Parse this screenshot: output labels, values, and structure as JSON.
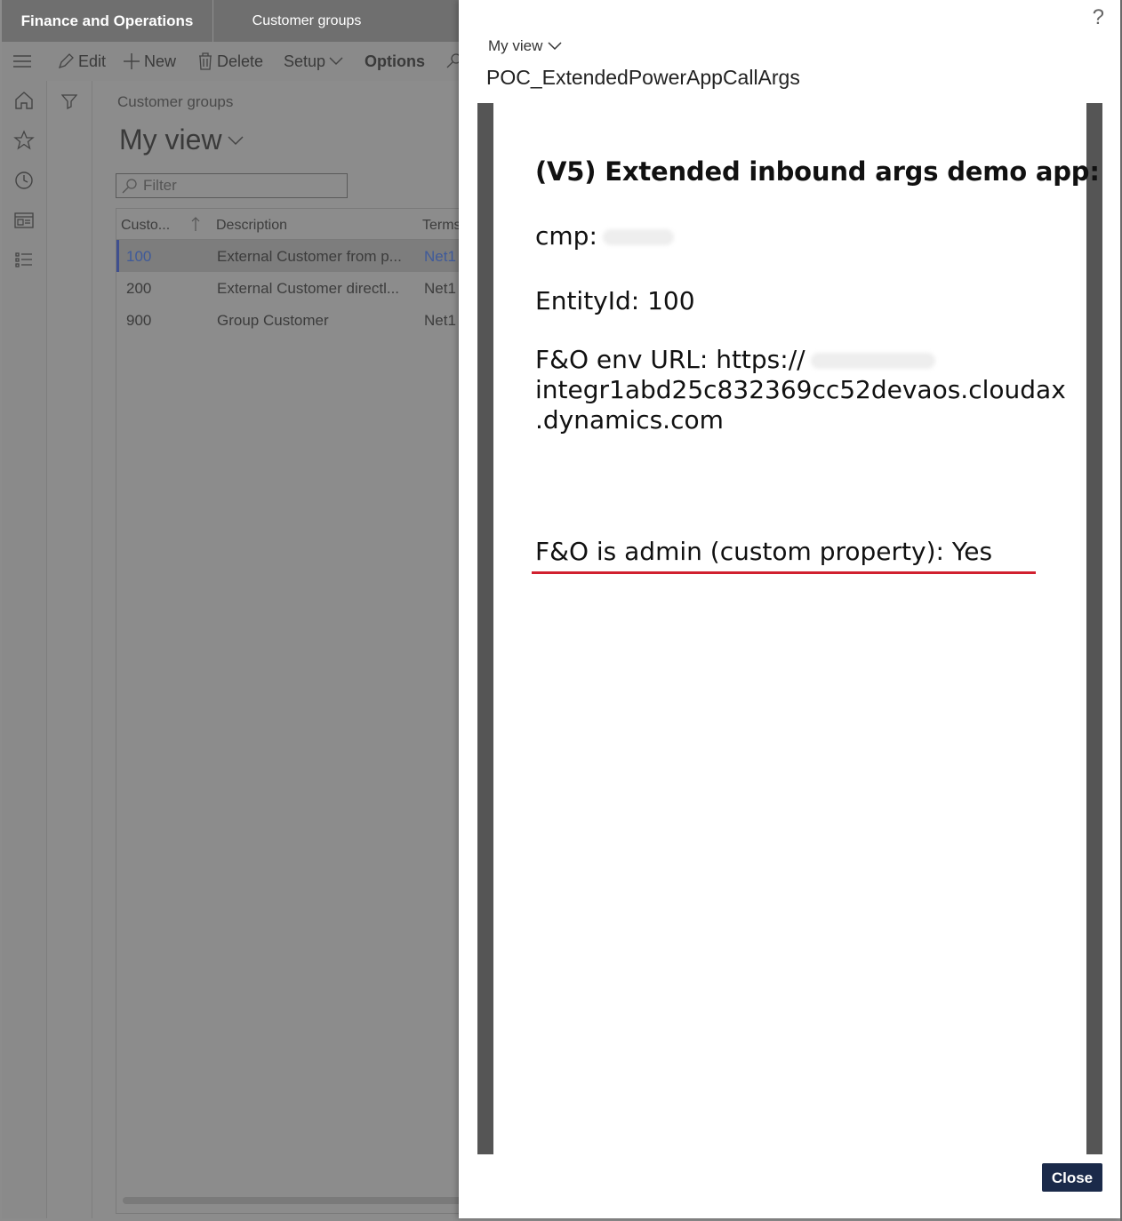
{
  "topbar": {
    "brand": "Finance and Operations",
    "breadcrumb": "Customer groups"
  },
  "commands": {
    "edit": "Edit",
    "new": "New",
    "delete": "Delete",
    "setup": "Setup",
    "options": "Options"
  },
  "page": {
    "breadcrumb": "Customer groups",
    "view": "My view",
    "filter_placeholder": "Filter"
  },
  "grid": {
    "columns": [
      "Custo...",
      "Description",
      "Terms"
    ],
    "rows": [
      {
        "id": "100",
        "description": "External Customer from p...",
        "terms": "Net1"
      },
      {
        "id": "200",
        "description": "External Customer directl...",
        "terms": "Net1"
      },
      {
        "id": "900",
        "description": "Group Customer",
        "terms": "Net1"
      }
    ]
  },
  "pane": {
    "help": "?",
    "view": "My view",
    "title": "POC_ExtendedPowerAppCallArgs",
    "app": {
      "heading": "(V5) Extended inbound args demo app:",
      "cmp_label": "cmp:",
      "entity": "EntityId: 100",
      "env_url_label": "F&O env URL: https://",
      "env_url_line2": "integr1abd25c832369cc52devaos.cloudax",
      "env_url_line3": ".dynamics.com",
      "admin": "F&O is admin (custom property): Yes"
    },
    "close": "Close"
  },
  "colors": {
    "accent_red": "#d1202f",
    "close_button": "#1b2a4a",
    "frame_border": "#555555",
    "selected_link": "#3f6fd6"
  }
}
